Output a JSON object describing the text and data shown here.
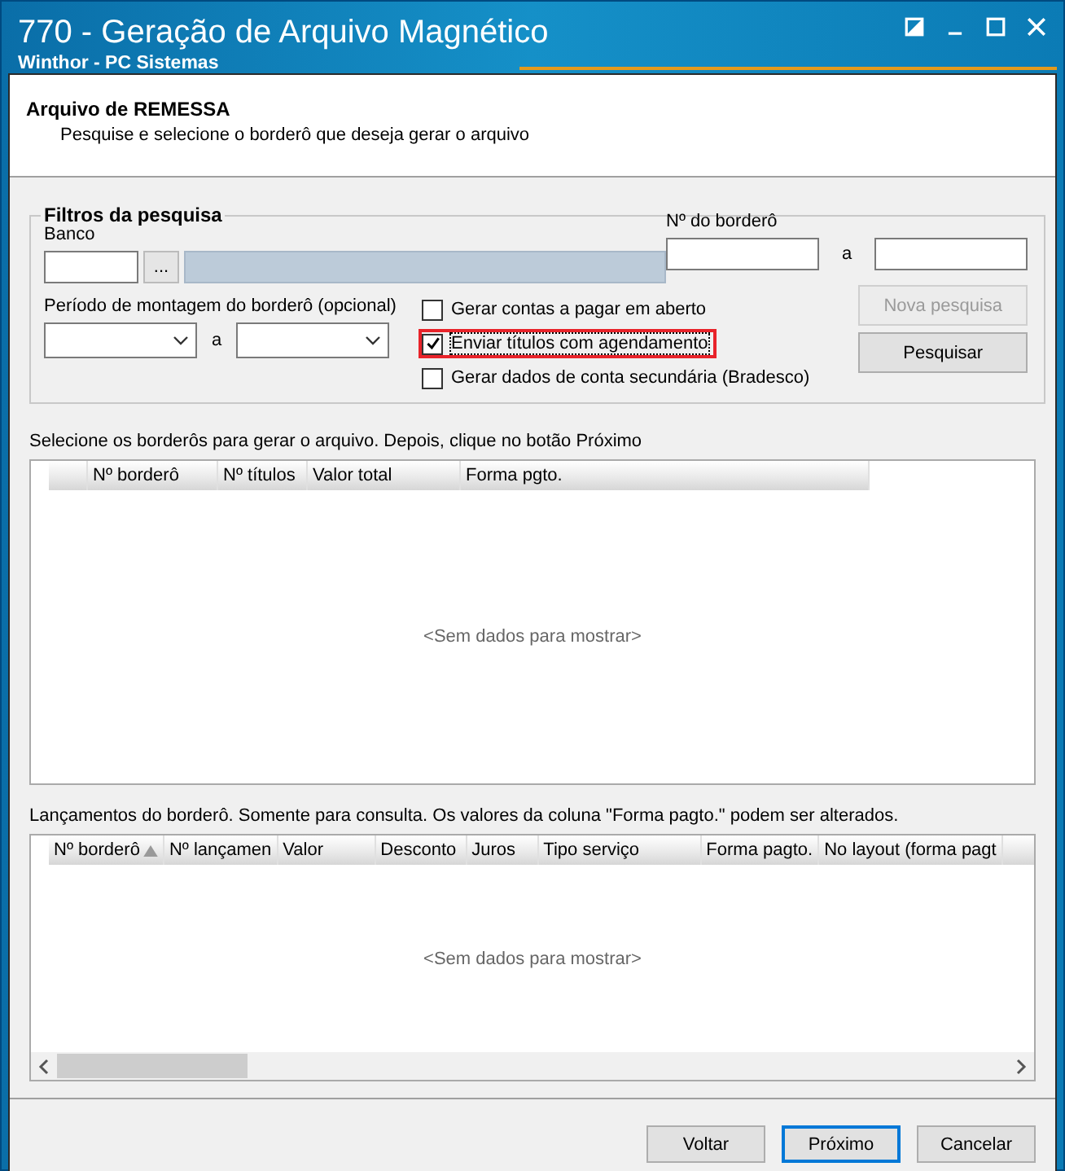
{
  "window": {
    "title": "770 - Geração de Arquivo Magnético",
    "subtitle": "Winthor - PC Sistemas"
  },
  "header": {
    "title": "Arquivo de REMESSA",
    "description": "Pesquise e selecione o borderô que deseja gerar o arquivo"
  },
  "filters": {
    "title": "Filtros da pesquisa",
    "bank_label": "Banco",
    "lookup_button": "...",
    "bordero_label": "Nº do borderô",
    "bordero_separator": "a",
    "period_label": "Período de montagem do borderô (opcional)",
    "period_separator": "a",
    "options": [
      {
        "label": "Gerar contas a pagar em aberto",
        "checked": false,
        "highlighted": false
      },
      {
        "label": "Enviar títulos com agendamento",
        "checked": true,
        "highlighted": true
      },
      {
        "label": "Gerar dados de conta secundária (Bradesco)",
        "checked": false,
        "highlighted": false
      }
    ],
    "buttons": [
      {
        "label": "Nova pesquisa",
        "disabled": true
      },
      {
        "label": "Pesquisar",
        "disabled": false
      }
    ]
  },
  "borderos": {
    "instruction": "Selecione os borderôs para gerar o arquivo. Depois, clique no botão Próximo",
    "columns": [
      {
        "label": "Nº borderô",
        "sorted": false
      },
      {
        "label": "Nº títulos",
        "sorted": false
      },
      {
        "label": "Valor total",
        "sorted": false
      },
      {
        "label": "Forma pgto.",
        "sorted": false
      }
    ],
    "empty_text": "<Sem dados para mostrar>"
  },
  "lancamentos": {
    "instruction": "Lançamentos do borderô. Somente para consulta. Os valores da coluna \"Forma pagto.\" podem ser alterados.",
    "columns": [
      {
        "label": "Nº borderô",
        "sorted": true
      },
      {
        "label": "Nº lançamen",
        "sorted": false
      },
      {
        "label": "Valor",
        "sorted": false
      },
      {
        "label": "Desconto",
        "sorted": false
      },
      {
        "label": "Juros",
        "sorted": false
      },
      {
        "label": "Tipo serviço",
        "sorted": false
      },
      {
        "label": "Forma pagto.",
        "sorted": false
      },
      {
        "label": "No layout (forma pagt",
        "sorted": false
      }
    ],
    "empty_text": "<Sem dados para mostrar>"
  },
  "footer_buttons": [
    {
      "label": "Voltar",
      "default": false
    },
    {
      "label": "Próximo",
      "default": true
    },
    {
      "label": "Cancelar",
      "default": false
    }
  ]
}
